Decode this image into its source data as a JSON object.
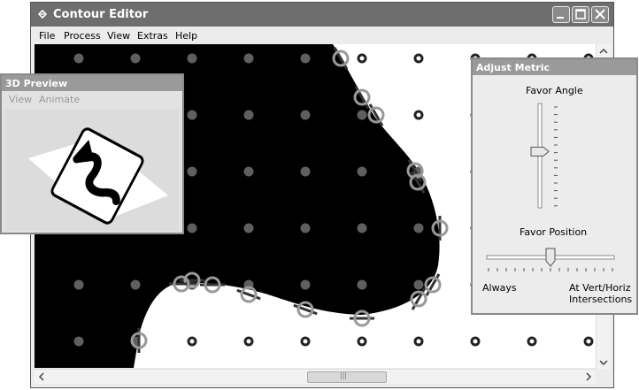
{
  "main_window": {
    "title": "Contour Editor",
    "menu": [
      "File",
      "Process",
      "View",
      "Extras",
      "Help"
    ],
    "scroll_grip": "|||"
  },
  "preview_window": {
    "title": "3D Preview",
    "menu": [
      "View",
      "Animate"
    ]
  },
  "metric_window": {
    "title": "Adjust Metric",
    "angle_label": "Favor Angle",
    "position_label": "Favor Position",
    "left_label": "Always",
    "right_label_line1": "At Vert/Horiz",
    "right_label_line2": "Intersections",
    "favor_angle_level": 0.55,
    "favor_position_level": 0.5
  },
  "colors": {
    "title_bar": "#6e6e6e",
    "tool_title": "#9a9a9a",
    "grid_filled": "#5f5f5f",
    "marker": "#999999"
  }
}
